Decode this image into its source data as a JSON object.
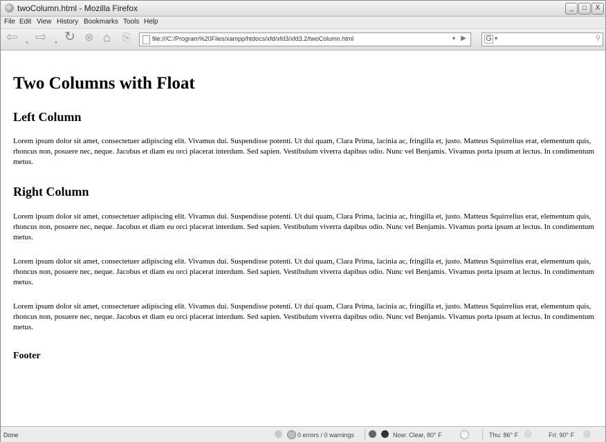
{
  "window": {
    "title": "twoColumn.html - Mozilla Firefox",
    "minimize": "_",
    "maximize": "□",
    "close": "X"
  },
  "menu": [
    "File",
    "Edit",
    "View",
    "History",
    "Bookmarks",
    "Tools",
    "Help"
  ],
  "nav": {
    "url": "file:///C:/Program%20Files/xampp/htdocs/xfd/xfd3/xfd3.2/twoColumn.html",
    "search_engine_glyph": "G",
    "search_value": ""
  },
  "page": {
    "title": "Two Columns with Float",
    "left_heading": "Left Column",
    "left_text": "Lorem ipsum dolor sit amet, consectetuer adipiscing elit. Vivamus dui. Suspendisse potenti. Ut dui quam, Clara Prima, lacinia ac, fringilla et, justo. Matteus Squirrelius erat, elementum quis, rhoncus non, posuere nec, neque. Jacobus et diam eu orci placerat interdum. Sed sapien. Vestibulum viverra dapibus odio. Nunc vel Benjamis. Vivamus porta ipsum at lectus. In condimentum metus.",
    "right_heading": "Right Column",
    "right_paragraphs": [
      "Lorem ipsum dolor sit amet, consectetuer adipiscing elit. Vivamus dui. Suspendisse potenti. Ut dui quam, Clara Prima, lacinia ac, fringilla et, justo. Matteus Squirrelius erat, elementum quis, rhoncus non, posuere nec, neque. Jacobus et diam eu orci placerat interdum. Sed sapien. Vestibulum viverra dapibus odio. Nunc vel Benjamis. Vivamus porta ipsum at lectus. In condimentum metus.",
      "Lorem ipsum dolor sit amet, consectetuer adipiscing elit. Vivamus dui. Suspendisse potenti. Ut dui quam, Clara Prima, lacinia ac, fringilla et, justo. Matteus Squirrelius erat, elementum quis, rhoncus non, posuere nec, neque. Jacobus et diam eu orci placerat interdum. Sed sapien. Vestibulum viverra dapibus odio. Nunc vel Benjamis. Vivamus porta ipsum at lectus. In condimentum metus.",
      "Lorem ipsum dolor sit amet, consectetuer adipiscing elit. Vivamus dui. Suspendisse potenti. Ut dui quam, Clara Prima, lacinia ac, fringilla et, justo. Matteus Squirrelius erat, elementum quis, rhoncus non, posuere nec, neque. Jacobus et diam eu orci placerat interdum. Sed sapien. Vestibulum viverra dapibus odio. Nunc vel Benjamis. Vivamus porta ipsum at lectus. In condimentum metus."
    ],
    "footer": "Footer"
  },
  "status": {
    "done": "Done",
    "errors": "0 errors / 0 warnings",
    "weather_now": "Now: Clear, 80° F",
    "weather_thu": "Thu: 86° F",
    "weather_fri": "Fri: 90° F"
  }
}
